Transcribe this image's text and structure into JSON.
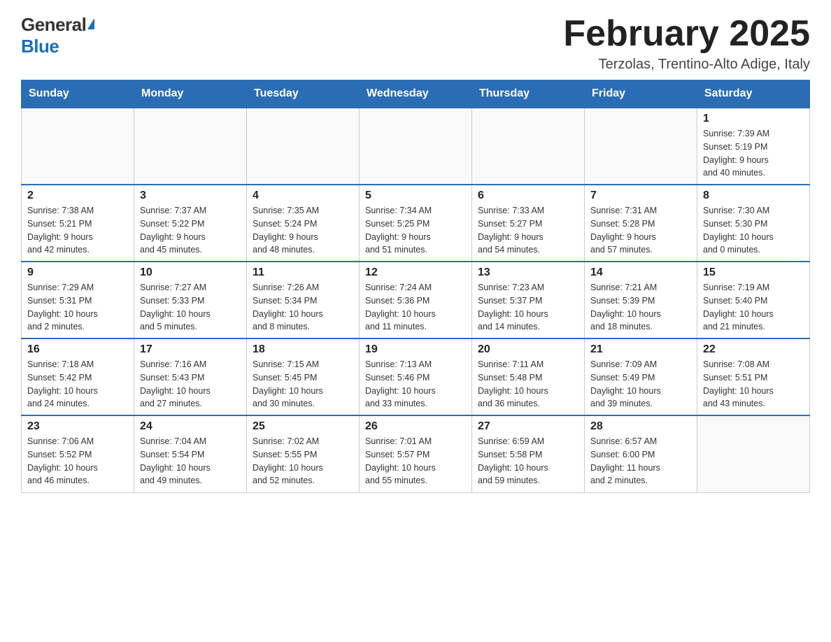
{
  "header": {
    "logo_general": "General",
    "logo_blue": "Blue",
    "month_title": "February 2025",
    "location": "Terzolas, Trentino-Alto Adige, Italy"
  },
  "days_of_week": [
    "Sunday",
    "Monday",
    "Tuesday",
    "Wednesday",
    "Thursday",
    "Friday",
    "Saturday"
  ],
  "weeks": [
    [
      {
        "day": "",
        "info": ""
      },
      {
        "day": "",
        "info": ""
      },
      {
        "day": "",
        "info": ""
      },
      {
        "day": "",
        "info": ""
      },
      {
        "day": "",
        "info": ""
      },
      {
        "day": "",
        "info": ""
      },
      {
        "day": "1",
        "info": "Sunrise: 7:39 AM\nSunset: 5:19 PM\nDaylight: 9 hours\nand 40 minutes."
      }
    ],
    [
      {
        "day": "2",
        "info": "Sunrise: 7:38 AM\nSunset: 5:21 PM\nDaylight: 9 hours\nand 42 minutes."
      },
      {
        "day": "3",
        "info": "Sunrise: 7:37 AM\nSunset: 5:22 PM\nDaylight: 9 hours\nand 45 minutes."
      },
      {
        "day": "4",
        "info": "Sunrise: 7:35 AM\nSunset: 5:24 PM\nDaylight: 9 hours\nand 48 minutes."
      },
      {
        "day": "5",
        "info": "Sunrise: 7:34 AM\nSunset: 5:25 PM\nDaylight: 9 hours\nand 51 minutes."
      },
      {
        "day": "6",
        "info": "Sunrise: 7:33 AM\nSunset: 5:27 PM\nDaylight: 9 hours\nand 54 minutes."
      },
      {
        "day": "7",
        "info": "Sunrise: 7:31 AM\nSunset: 5:28 PM\nDaylight: 9 hours\nand 57 minutes."
      },
      {
        "day": "8",
        "info": "Sunrise: 7:30 AM\nSunset: 5:30 PM\nDaylight: 10 hours\nand 0 minutes."
      }
    ],
    [
      {
        "day": "9",
        "info": "Sunrise: 7:29 AM\nSunset: 5:31 PM\nDaylight: 10 hours\nand 2 minutes."
      },
      {
        "day": "10",
        "info": "Sunrise: 7:27 AM\nSunset: 5:33 PM\nDaylight: 10 hours\nand 5 minutes."
      },
      {
        "day": "11",
        "info": "Sunrise: 7:26 AM\nSunset: 5:34 PM\nDaylight: 10 hours\nand 8 minutes."
      },
      {
        "day": "12",
        "info": "Sunrise: 7:24 AM\nSunset: 5:36 PM\nDaylight: 10 hours\nand 11 minutes."
      },
      {
        "day": "13",
        "info": "Sunrise: 7:23 AM\nSunset: 5:37 PM\nDaylight: 10 hours\nand 14 minutes."
      },
      {
        "day": "14",
        "info": "Sunrise: 7:21 AM\nSunset: 5:39 PM\nDaylight: 10 hours\nand 18 minutes."
      },
      {
        "day": "15",
        "info": "Sunrise: 7:19 AM\nSunset: 5:40 PM\nDaylight: 10 hours\nand 21 minutes."
      }
    ],
    [
      {
        "day": "16",
        "info": "Sunrise: 7:18 AM\nSunset: 5:42 PM\nDaylight: 10 hours\nand 24 minutes."
      },
      {
        "day": "17",
        "info": "Sunrise: 7:16 AM\nSunset: 5:43 PM\nDaylight: 10 hours\nand 27 minutes."
      },
      {
        "day": "18",
        "info": "Sunrise: 7:15 AM\nSunset: 5:45 PM\nDaylight: 10 hours\nand 30 minutes."
      },
      {
        "day": "19",
        "info": "Sunrise: 7:13 AM\nSunset: 5:46 PM\nDaylight: 10 hours\nand 33 minutes."
      },
      {
        "day": "20",
        "info": "Sunrise: 7:11 AM\nSunset: 5:48 PM\nDaylight: 10 hours\nand 36 minutes."
      },
      {
        "day": "21",
        "info": "Sunrise: 7:09 AM\nSunset: 5:49 PM\nDaylight: 10 hours\nand 39 minutes."
      },
      {
        "day": "22",
        "info": "Sunrise: 7:08 AM\nSunset: 5:51 PM\nDaylight: 10 hours\nand 43 minutes."
      }
    ],
    [
      {
        "day": "23",
        "info": "Sunrise: 7:06 AM\nSunset: 5:52 PM\nDaylight: 10 hours\nand 46 minutes."
      },
      {
        "day": "24",
        "info": "Sunrise: 7:04 AM\nSunset: 5:54 PM\nDaylight: 10 hours\nand 49 minutes."
      },
      {
        "day": "25",
        "info": "Sunrise: 7:02 AM\nSunset: 5:55 PM\nDaylight: 10 hours\nand 52 minutes."
      },
      {
        "day": "26",
        "info": "Sunrise: 7:01 AM\nSunset: 5:57 PM\nDaylight: 10 hours\nand 55 minutes."
      },
      {
        "day": "27",
        "info": "Sunrise: 6:59 AM\nSunset: 5:58 PM\nDaylight: 10 hours\nand 59 minutes."
      },
      {
        "day": "28",
        "info": "Sunrise: 6:57 AM\nSunset: 6:00 PM\nDaylight: 11 hours\nand 2 minutes."
      },
      {
        "day": "",
        "info": ""
      }
    ]
  ]
}
